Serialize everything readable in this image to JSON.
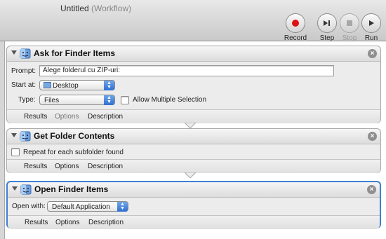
{
  "window": {
    "title": "Untitled",
    "subtitle": "(Workflow)"
  },
  "toolbar": {
    "record": "Record",
    "step": "Step",
    "stop": "Stop",
    "run": "Run"
  },
  "actions": [
    {
      "title": "Ask for Finder Items",
      "prompt_label": "Prompt:",
      "prompt_value": "Alege folderul cu ZIP-uri:",
      "start_at_label": "Start at:",
      "start_at_value": "Desktop",
      "type_label": "Type:",
      "type_value": "Files",
      "allow_multiple_label": "Allow Multiple Selection",
      "tabs": [
        "Results",
        "Options",
        "Description"
      ]
    },
    {
      "title": "Get Folder Contents",
      "repeat_label": "Repeat for each subfolder found",
      "tabs": [
        "Results",
        "Options",
        "Description"
      ]
    },
    {
      "title": "Open Finder Items",
      "open_with_label": "Open with:",
      "open_with_value": "Default Application",
      "tabs": [
        "Results",
        "Options",
        "Description"
      ]
    }
  ],
  "colors": {
    "accent": "#3f7fd3",
    "record_red": "#e01010"
  }
}
